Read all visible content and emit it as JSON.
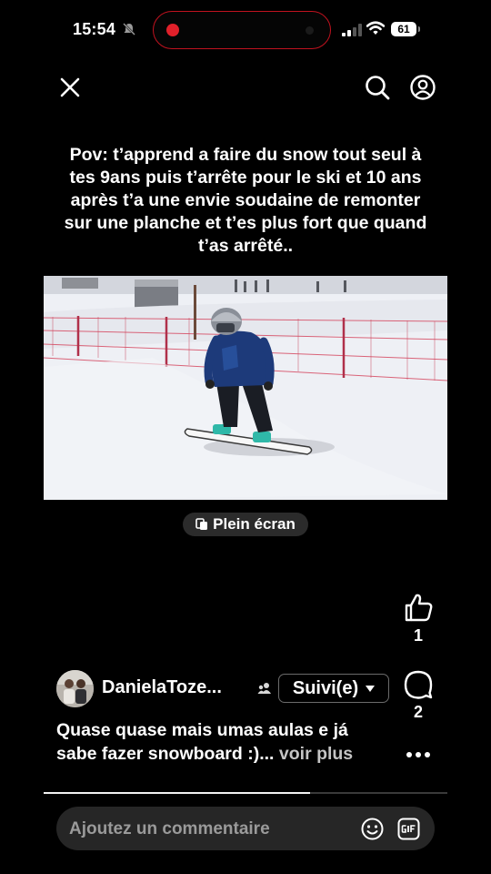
{
  "status_bar": {
    "time": "15:54",
    "battery": "61"
  },
  "post": {
    "title": "Pov: t’apprend a faire du snow tout seul à tes 9ans puis t’arrête pour le ski et 10 ans après t’a une envie soudaine de remonter sur une planche et t’es plus fort que quand t’as arrêté..",
    "fullscreen_label": "Plein écran",
    "likes": "1",
    "comments": "2",
    "author": "DanielaToze...",
    "follow_label": "Suivi(e)",
    "description": "Quase quase mais umas aulas e já sabe fazer snowboard :)...",
    "see_more": "voir plus",
    "progress": 0.66
  },
  "comment_input": {
    "placeholder": "Ajoutez un commentaire"
  },
  "icons": [
    "close-icon",
    "search-icon",
    "profile-icon",
    "like-icon",
    "comment-icon",
    "more-icon",
    "emoji-icon",
    "gif-icon",
    "fullscreen-icon",
    "chevron-down-icon",
    "group-icon",
    "mute-icon",
    "signal-icon",
    "wifi-icon"
  ],
  "colors": {
    "background": "#000000",
    "recording": "#e0202a",
    "input_bg": "#262626"
  }
}
